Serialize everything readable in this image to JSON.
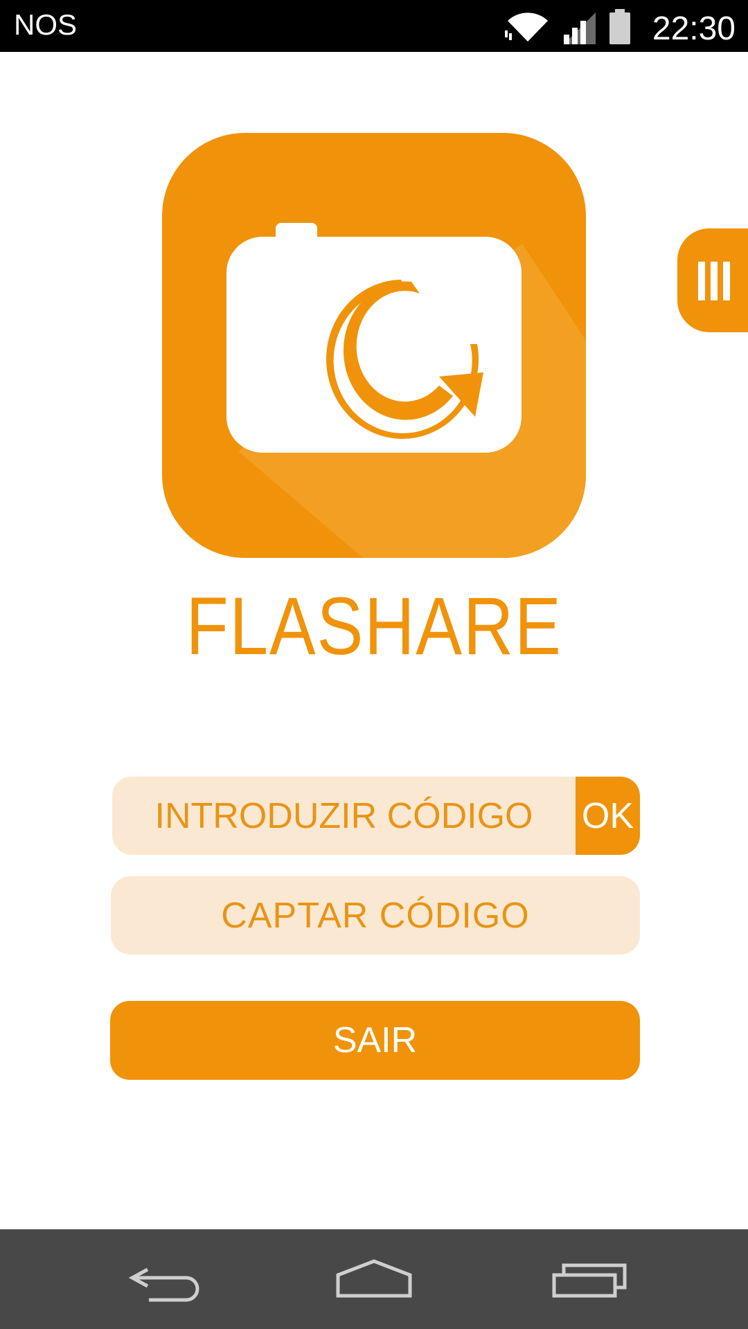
{
  "status_bar": {
    "carrier": "NOS",
    "time": "22:30",
    "icons": [
      "wifi-icon",
      "signal-icon",
      "battery-icon"
    ]
  },
  "app": {
    "brand_name": "FLASHARE",
    "logo_icon": "camera-share-icon",
    "menu_icon": "menu-bars-icon"
  },
  "buttons": {
    "code_placeholder": "INTRODUZIR CÓDIGO",
    "ok_label": "OK",
    "capture_label": "CAPTAR CÓDIGO",
    "exit_label": "SAIR"
  },
  "nav_bar": {
    "icons": [
      "back-icon",
      "home-icon",
      "recents-icon"
    ]
  },
  "colors": {
    "accent": "#f0930a",
    "accent_light": "#fae8d3",
    "status_bar": "#000000",
    "nav_bar": "#484848"
  }
}
